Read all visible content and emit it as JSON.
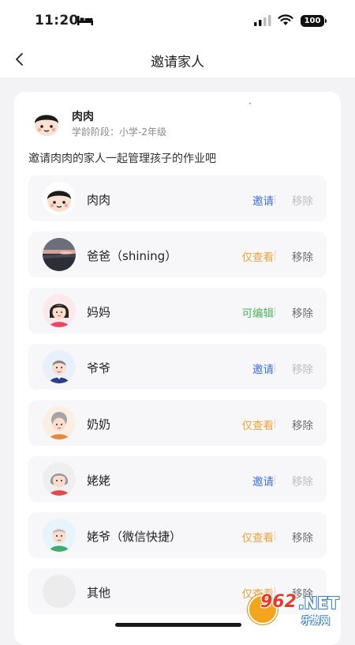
{
  "status_bar": {
    "time": "11:20",
    "battery": "100",
    "icons": [
      "bed-icon",
      "signal-icon",
      "wifi-icon",
      "battery-icon"
    ]
  },
  "nav": {
    "title": "邀请家人",
    "back_icon": "back-arrow-icon"
  },
  "child": {
    "name": "肉肉",
    "stage": "学龄阶段：小学-2年级"
  },
  "intro": "邀请肉肉的家人一起管理孩子的作业吧",
  "colors": {
    "invite": "#3e6fd8",
    "view_only": "#f0a43a",
    "editable": "#4fb35b",
    "remove_disabled": "#bdbdbd",
    "remove_enabled": "#6a6a6a"
  },
  "members": [
    {
      "name": "肉肉",
      "action": "邀请",
      "status": "invite",
      "remove": "移除",
      "remove_enabled": false
    },
    {
      "name": "爸爸（shining）",
      "action": "仅查看",
      "status": "view",
      "remove": "移除",
      "remove_enabled": true
    },
    {
      "name": "妈妈",
      "action": "可编辑",
      "status": "edit",
      "remove": "移除",
      "remove_enabled": true
    },
    {
      "name": "爷爷",
      "action": "邀请",
      "status": "invite",
      "remove": "移除",
      "remove_enabled": false
    },
    {
      "name": "奶奶",
      "action": "仅查看",
      "status": "view",
      "remove": "移除",
      "remove_enabled": true
    },
    {
      "name": "姥姥",
      "action": "邀请",
      "status": "invite",
      "remove": "移除",
      "remove_enabled": false
    },
    {
      "name": "姥爷（微信快捷）",
      "action": "仅查看",
      "status": "view",
      "remove": "移除",
      "remove_enabled": true
    },
    {
      "name": "其他",
      "action": "仅查看",
      "status": "view",
      "remove": "移除",
      "remove_enabled": true
    }
  ],
  "watermark": {
    "number": "962",
    "suffix": ".NET",
    "sub": "乐游网"
  }
}
